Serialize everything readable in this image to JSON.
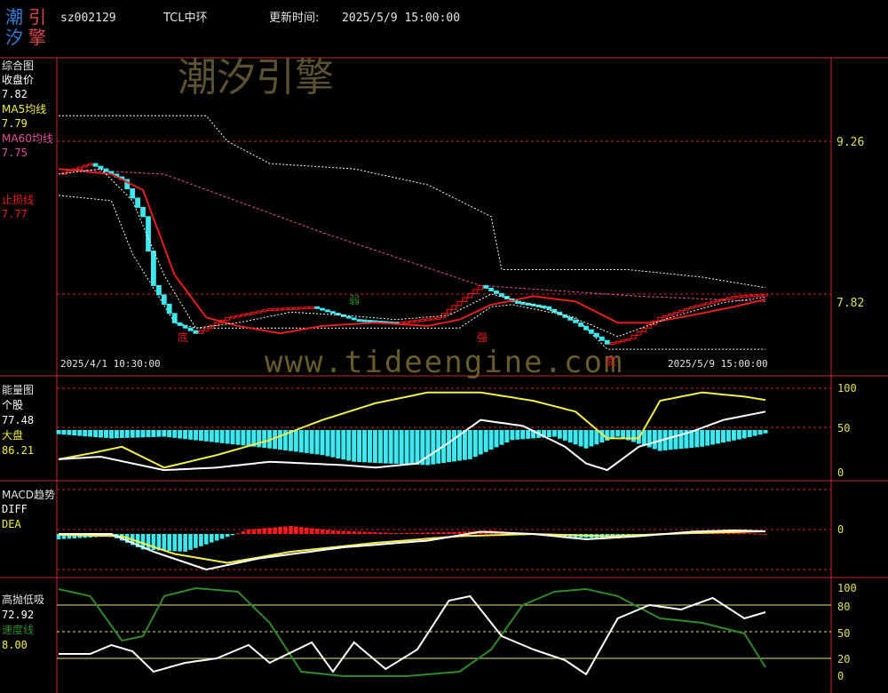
{
  "header": {
    "logo_chars": [
      "潮",
      "引",
      "汐",
      "擎"
    ],
    "code": "sz002129",
    "name": "TCL中环",
    "update_label": "更新时间:",
    "update_time": "2025/5/9 15:00:00"
  },
  "watermarks": {
    "brand": "潮汐引擎",
    "url": "www.tideengine.com"
  },
  "colors": {
    "background": "#000000",
    "grid_red": "#c8262c",
    "cyan": "#3fe8ee",
    "red_bar": "#ff1a1a",
    "ma5_yellow": "#f4ef4d",
    "ma60_pink": "#e0509a",
    "stop_line": "#e61e1e",
    "white": "#ffffff",
    "green": "#2f8a2a"
  },
  "panels": {
    "main": {
      "title": "综合图",
      "legend": [
        {
          "label": "收盘价",
          "value": "7.82",
          "color": "#ffffff"
        },
        {
          "label": "MA5均线",
          "value": "7.79",
          "color": "#f4ef4d"
        },
        {
          "label": "MA60均线",
          "value": "7.75",
          "color": "#e0509a"
        },
        {
          "label": "止损线",
          "value": "7.77",
          "color": "#e61e1e"
        }
      ],
      "axis_labels": [
        "9.26",
        "7.82"
      ],
      "date_start": "2025/4/1 10:30:00",
      "date_end": "2025/5/9 15:00:00",
      "annotations": [
        "底",
        "弱",
        "强",
        "底"
      ]
    },
    "energy": {
      "title": "能量图",
      "legend": [
        {
          "label": "个股",
          "value": "77.48",
          "color": "#ffffff"
        },
        {
          "label": "大盘",
          "value": "86.21",
          "color": "#f4ef4d"
        }
      ],
      "axis_labels": [
        "100",
        "50",
        "0"
      ]
    },
    "macd": {
      "title": "MACD趋势",
      "legend": [
        {
          "label": "DIFF",
          "color": "#ffffff"
        },
        {
          "label": "DEA",
          "color": "#f4ef4d"
        }
      ],
      "axis_labels": [
        "0"
      ]
    },
    "kdj": {
      "title": "高抛低吸",
      "legend": [
        {
          "label": "72.92",
          "color": "#ffffff"
        },
        {
          "label": "速度线",
          "color": "#2f8a2a"
        },
        {
          "label": "8.00",
          "color": "#f4ef4d"
        }
      ],
      "axis_labels": [
        "100",
        "80",
        "50",
        "20",
        "0"
      ]
    }
  },
  "chart_data": {
    "type": "candlestick-with-indicators",
    "main": {
      "x_range": [
        "2025/4/1 10:30:00",
        "2025/5/9 15:00:00"
      ],
      "close_marks": [
        8.25,
        9.26,
        7.82
      ],
      "close_keypoints": [
        [
          0,
          8.95
        ],
        [
          6,
          9.05
        ],
        [
          12,
          8.9
        ],
        [
          16,
          8.55
        ],
        [
          18,
          7.9
        ],
        [
          22,
          7.55
        ],
        [
          26,
          7.45
        ],
        [
          32,
          7.6
        ],
        [
          40,
          7.68
        ],
        [
          48,
          7.7
        ],
        [
          56,
          7.58
        ],
        [
          64,
          7.55
        ],
        [
          72,
          7.6
        ],
        [
          80,
          7.9
        ],
        [
          86,
          7.75
        ],
        [
          92,
          7.7
        ],
        [
          98,
          7.55
        ],
        [
          104,
          7.35
        ],
        [
          108,
          7.4
        ],
        [
          114,
          7.6
        ],
        [
          120,
          7.7
        ],
        [
          128,
          7.8
        ],
        [
          134,
          7.82
        ]
      ],
      "ma5_keypoints": [
        [
          0,
          8.95
        ],
        [
          8,
          9.0
        ],
        [
          14,
          8.7
        ],
        [
          20,
          8.0
        ],
        [
          26,
          7.5
        ],
        [
          34,
          7.55
        ],
        [
          44,
          7.65
        ],
        [
          54,
          7.62
        ],
        [
          64,
          7.58
        ],
        [
          74,
          7.62
        ],
        [
          82,
          7.82
        ],
        [
          90,
          7.72
        ],
        [
          100,
          7.55
        ],
        [
          106,
          7.42
        ],
        [
          116,
          7.6
        ],
        [
          126,
          7.74
        ],
        [
          134,
          7.79
        ]
      ],
      "ma60_keypoints": [
        [
          0,
          9.0
        ],
        [
          20,
          8.95
        ],
        [
          50,
          8.4
        ],
        [
          80,
          7.9
        ],
        [
          110,
          7.8
        ],
        [
          134,
          7.75
        ]
      ],
      "stop_keypoints": [
        [
          0,
          9.0
        ],
        [
          10,
          8.95
        ],
        [
          16,
          8.8
        ],
        [
          22,
          8.0
        ],
        [
          28,
          7.6
        ],
        [
          34,
          7.52
        ],
        [
          42,
          7.45
        ],
        [
          50,
          7.52
        ],
        [
          60,
          7.55
        ],
        [
          70,
          7.52
        ],
        [
          76,
          7.58
        ],
        [
          82,
          7.72
        ],
        [
          90,
          7.8
        ],
        [
          98,
          7.75
        ],
        [
          106,
          7.55
        ],
        [
          112,
          7.55
        ],
        [
          120,
          7.62
        ],
        [
          128,
          7.7
        ],
        [
          134,
          7.77
        ]
      ],
      "upper_band_keypoints": [
        [
          0,
          9.5
        ],
        [
          28,
          9.5
        ],
        [
          32,
          9.26
        ],
        [
          40,
          9.05
        ],
        [
          56,
          9.0
        ],
        [
          70,
          8.85
        ],
        [
          82,
          8.55
        ],
        [
          84,
          8.05
        ],
        [
          108,
          8.05
        ],
        [
          122,
          7.98
        ],
        [
          134,
          7.88
        ]
      ],
      "lower_band_keypoints": [
        [
          0,
          8.75
        ],
        [
          10,
          8.7
        ],
        [
          14,
          8.2
        ],
        [
          22,
          7.55
        ],
        [
          26,
          7.5
        ],
        [
          60,
          7.5
        ],
        [
          76,
          7.5
        ],
        [
          82,
          7.7
        ],
        [
          86,
          7.72
        ],
        [
          98,
          7.6
        ],
        [
          104,
          7.3
        ],
        [
          120,
          7.3
        ],
        [
          134,
          7.3
        ]
      ]
    },
    "energy": {
      "y_range": [
        0,
        100
      ],
      "individual_keypoints": [
        [
          0,
          15
        ],
        [
          8,
          18
        ],
        [
          14,
          10
        ],
        [
          20,
          2
        ],
        [
          30,
          5
        ],
        [
          40,
          12
        ],
        [
          54,
          8
        ],
        [
          60,
          5
        ],
        [
          68,
          10
        ],
        [
          74,
          35
        ],
        [
          80,
          62
        ],
        [
          88,
          55
        ],
        [
          96,
          30
        ],
        [
          100,
          10
        ],
        [
          104,
          2
        ],
        [
          110,
          30
        ],
        [
          120,
          48
        ],
        [
          126,
          62
        ],
        [
          134,
          72
        ]
      ],
      "market_keypoints": [
        [
          0,
          15
        ],
        [
          6,
          22
        ],
        [
          12,
          30
        ],
        [
          20,
          5
        ],
        [
          30,
          20
        ],
        [
          40,
          38
        ],
        [
          50,
          62
        ],
        [
          60,
          82
        ],
        [
          70,
          95
        ],
        [
          80,
          95
        ],
        [
          90,
          85
        ],
        [
          98,
          72
        ],
        [
          104,
          40
        ],
        [
          110,
          40
        ],
        [
          114,
          85
        ],
        [
          122,
          95
        ],
        [
          130,
          90
        ],
        [
          134,
          86
        ]
      ],
      "bars_keypoints": [
        [
          0,
          45
        ],
        [
          10,
          40
        ],
        [
          20,
          42
        ],
        [
          30,
          35
        ],
        [
          40,
          28
        ],
        [
          50,
          20
        ],
        [
          56,
          12
        ],
        [
          62,
          10
        ],
        [
          70,
          8
        ],
        [
          78,
          15
        ],
        [
          86,
          38
        ],
        [
          94,
          42
        ],
        [
          100,
          28
        ],
        [
          106,
          42
        ],
        [
          114,
          25
        ],
        [
          122,
          30
        ],
        [
          130,
          40
        ],
        [
          134,
          46
        ]
      ]
    },
    "macd": {
      "y_range": [
        -1,
        1
      ],
      "diff_keypoints": [
        [
          0,
          0.0
        ],
        [
          10,
          0.0
        ],
        [
          18,
          -0.4
        ],
        [
          28,
          -0.8
        ],
        [
          38,
          -0.55
        ],
        [
          54,
          -0.3
        ],
        [
          70,
          -0.15
        ],
        [
          80,
          0.05
        ],
        [
          90,
          0.0
        ],
        [
          100,
          -0.12
        ],
        [
          110,
          -0.05
        ],
        [
          120,
          0.05
        ],
        [
          128,
          0.08
        ],
        [
          134,
          0.06
        ]
      ],
      "dea_keypoints": [
        [
          0,
          -0.02
        ],
        [
          12,
          -0.05
        ],
        [
          22,
          -0.45
        ],
        [
          32,
          -0.65
        ],
        [
          44,
          -0.4
        ],
        [
          60,
          -0.2
        ],
        [
          76,
          -0.05
        ],
        [
          90,
          0.0
        ],
        [
          104,
          -0.05
        ],
        [
          120,
          0.02
        ],
        [
          134,
          0.06
        ]
      ],
      "hist_keypoints": [
        [
          0,
          -0.12
        ],
        [
          10,
          -0.05
        ],
        [
          16,
          -0.35
        ],
        [
          24,
          -0.4
        ],
        [
          30,
          -0.15
        ],
        [
          36,
          0.1
        ],
        [
          44,
          0.18
        ],
        [
          52,
          0.08
        ],
        [
          64,
          0.02
        ],
        [
          74,
          0.04
        ],
        [
          82,
          0.08
        ],
        [
          90,
          0.0
        ],
        [
          98,
          -0.08
        ],
        [
          106,
          -0.1
        ],
        [
          114,
          0.02
        ],
        [
          124,
          0.05
        ],
        [
          134,
          0.0
        ]
      ]
    },
    "kdj": {
      "y_range": [
        0,
        100
      ],
      "white_keypoints": [
        [
          0,
          25
        ],
        [
          6,
          25
        ],
        [
          10,
          35
        ],
        [
          14,
          28
        ],
        [
          18,
          5
        ],
        [
          24,
          15
        ],
        [
          30,
          20
        ],
        [
          36,
          35
        ],
        [
          40,
          15
        ],
        [
          48,
          38
        ],
        [
          52,
          5
        ],
        [
          56,
          38
        ],
        [
          62,
          8
        ],
        [
          68,
          30
        ],
        [
          74,
          85
        ],
        [
          78,
          90
        ],
        [
          84,
          45
        ],
        [
          90,
          30
        ],
        [
          96,
          18
        ],
        [
          100,
          2
        ],
        [
          106,
          65
        ],
        [
          112,
          80
        ],
        [
          118,
          75
        ],
        [
          124,
          88
        ],
        [
          130,
          65
        ],
        [
          134,
          72
        ]
      ],
      "green_keypoints": [
        [
          0,
          98
        ],
        [
          6,
          90
        ],
        [
          12,
          40
        ],
        [
          16,
          45
        ],
        [
          20,
          90
        ],
        [
          26,
          99
        ],
        [
          34,
          95
        ],
        [
          40,
          60
        ],
        [
          46,
          5
        ],
        [
          54,
          0
        ],
        [
          66,
          0
        ],
        [
          76,
          5
        ],
        [
          82,
          30
        ],
        [
          88,
          80
        ],
        [
          94,
          95
        ],
        [
          100,
          98
        ],
        [
          106,
          90
        ],
        [
          114,
          65
        ],
        [
          122,
          60
        ],
        [
          130,
          48
        ],
        [
          134,
          10
        ]
      ]
    }
  }
}
